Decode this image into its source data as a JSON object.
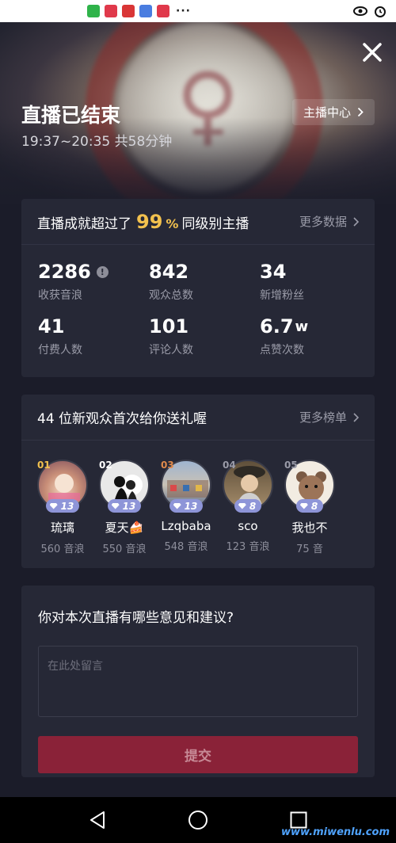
{
  "status_bar": {
    "dots": "···"
  },
  "header": {
    "title": "直播已结束",
    "subtitle": "19:37~20:35 共58分钟",
    "host_center": "主播中心"
  },
  "achievement": {
    "prefix": "直播成就超过了",
    "percent": "99",
    "percent_symbol": "%",
    "suffix": "同级别主播",
    "more": "更多数据"
  },
  "stats": [
    {
      "value": "2286",
      "unit": "",
      "label": "收获音浪",
      "info": "!"
    },
    {
      "value": "842",
      "unit": "",
      "label": "观众总数"
    },
    {
      "value": "34",
      "unit": "",
      "label": "新增粉丝"
    },
    {
      "value": "41",
      "unit": "",
      "label": "付费人数"
    },
    {
      "value": "101",
      "unit": "",
      "label": "评论人数"
    },
    {
      "value": "6.7",
      "unit": "w",
      "label": "点赞次数"
    }
  ],
  "gifts": {
    "title": "44 位新观众首次给你送礼喔",
    "more": "更多榜单",
    "viewers": [
      {
        "rank": "01",
        "level": "13",
        "name": "琉璃",
        "amount": "560 音浪",
        "rank_color": "#f2c14e"
      },
      {
        "rank": "02",
        "level": "13",
        "name": "夏天🍰",
        "amount": "550 音浪",
        "rank_color": "#ffffff"
      },
      {
        "rank": "03",
        "level": "13",
        "name": "Lzqbaba",
        "amount": "548 音浪",
        "rank_color": "#e08a4c"
      },
      {
        "rank": "04",
        "level": "8",
        "name": "sco",
        "amount": "123 音浪",
        "rank_color": "#9a9ba8"
      },
      {
        "rank": "05",
        "level": "8",
        "name": "我也不",
        "amount": "75 音",
        "rank_color": "#9a9ba8"
      }
    ]
  },
  "feedback": {
    "question": "你对本次直播有哪些意见和建议?",
    "placeholder": "在此处留言",
    "submit": "提交"
  },
  "watermark": "www.miwenlu.com",
  "icons": {
    "close": "close-icon",
    "chevron": "chevron-right-icon",
    "info": "info-icon",
    "back": "back-icon",
    "home": "home-icon",
    "recents": "recents-icon"
  }
}
